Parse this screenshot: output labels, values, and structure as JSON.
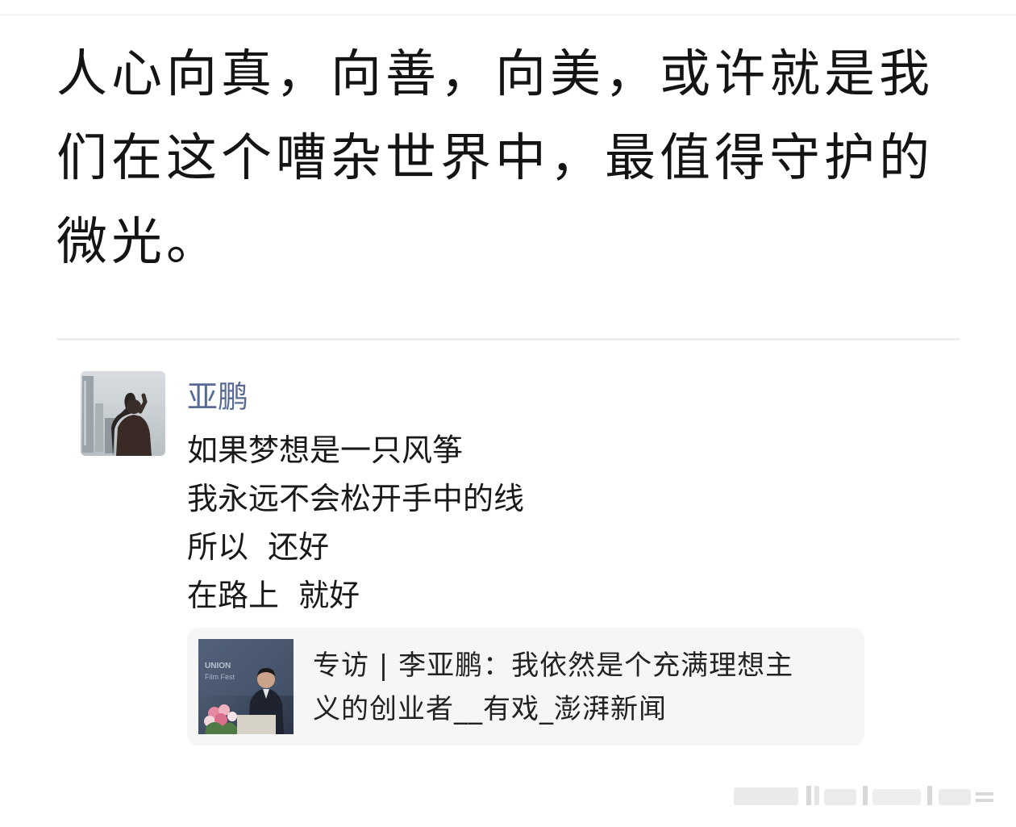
{
  "post": {
    "text_lines": [
      "人心向真，向善，向美，或许就是我",
      "们在这个嘈杂世界中，最值得守护的",
      "微光。"
    ]
  },
  "moment": {
    "nickname": "亚鹏",
    "lines": [
      "如果梦想是一只风筝",
      "我永远不会松开手中的线",
      "所以  还好",
      "在路上  就好"
    ],
    "link": {
      "title_lines": [
        "专访 | 李亚鹏：我依然是个充满理想主",
        "义的创业者__有戏_澎湃新闻"
      ],
      "thumb_text": "UNION Film Fest"
    }
  },
  "colors": {
    "nickname": "#576b95",
    "card_background": "#f6f6f6"
  }
}
